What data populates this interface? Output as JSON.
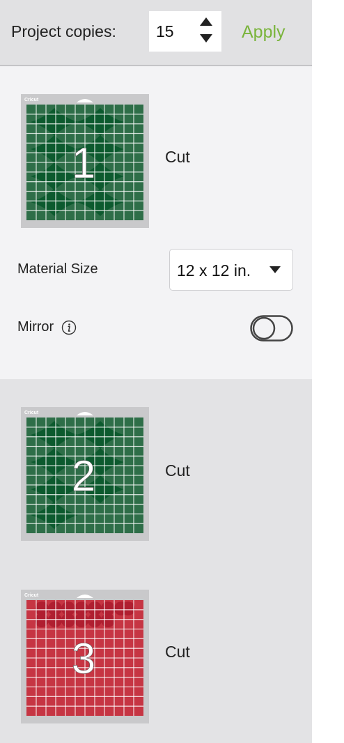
{
  "copies": {
    "label": "Project copies:",
    "value": "15",
    "apply_label": "Apply",
    "apply_color": "#7ab43c"
  },
  "mats": [
    {
      "number": "1",
      "label": "Cut",
      "color": "#2e6e48",
      "shape_color": "#0c5a2e",
      "shape": "diamond-icon"
    },
    {
      "number": "2",
      "label": "Cut",
      "color": "#2e6e48",
      "shape_color": "#0c5a2e",
      "shape": "diamond-icon"
    },
    {
      "number": "3",
      "label": "Cut",
      "color": "#c63543",
      "shape_color": "#b01e30",
      "shape": "circle-icon"
    }
  ],
  "mat_brand": "Cricut",
  "material_size": {
    "label": "Material Size",
    "value": "12 x 12 in."
  },
  "mirror": {
    "label": "Mirror",
    "on": false
  }
}
